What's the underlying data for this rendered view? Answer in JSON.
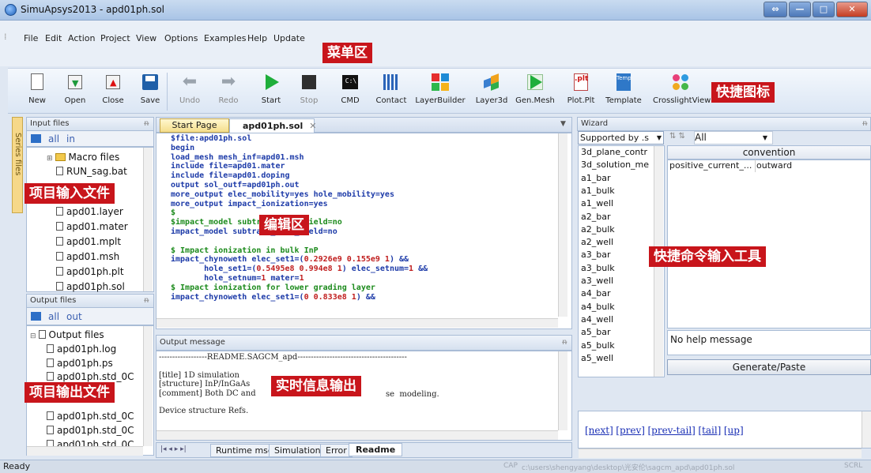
{
  "window": {
    "title": "SimuApsys2013 - apd01ph.sol"
  },
  "menu": [
    "File",
    "Edit",
    "Action",
    "Project",
    "View",
    "Options",
    "Examples",
    "Help",
    "Update"
  ],
  "annotations": {
    "menu_area": "菜单区",
    "shortcut_icons": "快捷图标",
    "project_input": "项目输入文件",
    "editor_area": "编辑区",
    "quick_command": "快捷命令输入工具",
    "project_output": "项目输出文件",
    "realtime_output": "实时信息输出"
  },
  "toolbar": [
    {
      "label": "New",
      "icon": "new-doc-icon",
      "enabled": true
    },
    {
      "label": "Open",
      "icon": "open-icon",
      "enabled": true
    },
    {
      "label": "Close",
      "icon": "close-doc-icon",
      "enabled": true
    },
    {
      "label": "Save",
      "icon": "save-icon",
      "enabled": true
    },
    {
      "label": "Undo",
      "icon": "undo-icon",
      "enabled": false
    },
    {
      "label": "Redo",
      "icon": "redo-icon",
      "enabled": false
    },
    {
      "label": "Start",
      "icon": "play-icon",
      "enabled": true
    },
    {
      "label": "Stop",
      "icon": "stop-icon",
      "enabled": false
    },
    {
      "label": "CMD",
      "icon": "cmd-icon",
      "enabled": true
    },
    {
      "label": "Contact",
      "icon": "contact-icon",
      "enabled": true
    },
    {
      "label": "LayerBuilder",
      "icon": "layerbuilder-icon",
      "enabled": true
    },
    {
      "label": "Layer3d",
      "icon": "layer3d-icon",
      "enabled": true
    },
    {
      "label": "Gen.Mesh",
      "icon": "genmesh-icon",
      "enabled": true
    },
    {
      "label": "Plot.Plt",
      "icon": "plot-icon",
      "enabled": true
    },
    {
      "label": "Template",
      "icon": "template-icon",
      "enabled": true
    },
    {
      "label": "CrosslightView",
      "icon": "crosslightview-icon",
      "enabled": true
    }
  ],
  "input_panel": {
    "header": "Input files",
    "filters": [
      "all",
      "in"
    ],
    "side_tab": "Series files",
    "items": [
      "Macro files",
      "RUN_sag.bat",
      "apd01.layer",
      "apd01.mater",
      "apd01.mplt",
      "apd01.msh",
      "apd01ph.plt",
      "apd01ph.sol"
    ]
  },
  "output_panel": {
    "header": "Output files",
    "filters": [
      "all",
      "out"
    ],
    "items": [
      "Output files",
      "apd01ph.log",
      "apd01ph.ps",
      "apd01ph.std_0C",
      "apd01ph.std_0C",
      "apd01ph.std_0C",
      "apd01ph.std_0C"
    ]
  },
  "editor": {
    "tabs": [
      "Start Page",
      "apd01ph.sol"
    ],
    "active_tab": "apd01ph.sol"
  },
  "output_message": {
    "header": "Output message",
    "lines": [
      "------------------README.SAGCM_apd-----------------------------------------",
      "",
      "[title] 1D simulation",
      "[structure] InP/InGaAs",
      "[comment] Both DC and",
      "",
      "Device structure Refs."
    ],
    "tail_text": "se  modeling.",
    "tabs": [
      "Runtime msg",
      "Simulation",
      "Error",
      "Readme"
    ],
    "active_tab": "Readme"
  },
  "wizard": {
    "header": "Wizard",
    "dropdown": "Supported by .s",
    "filter": "All",
    "items": [
      "3d_plane_contr",
      "3d_solution_me",
      "a1_bar",
      "a1_bulk",
      "a1_well",
      "a2_bar",
      "a2_bulk",
      "a2_well",
      "a3_bar",
      "a3_bulk",
      "a3_well",
      "a4_bar",
      "a4_bulk",
      "a4_well",
      "a5_bar",
      "a5_bulk",
      "a5_well"
    ],
    "column_header": "convention",
    "property": {
      "name": "positive_current_...",
      "value": "outward"
    },
    "help": "No help message",
    "button": "Generate/Paste",
    "nav_links": [
      "[next]",
      "[prev]",
      "[prev-tail]",
      "[tail]",
      "[up]"
    ]
  },
  "statusbar": {
    "left": "Ready",
    "cap": "CAP",
    "path": "c:\\users\\shengyang\\desktop\\光安伦\\sagcm_apd\\apd01ph.sol",
    "scrl": "SCRL"
  }
}
